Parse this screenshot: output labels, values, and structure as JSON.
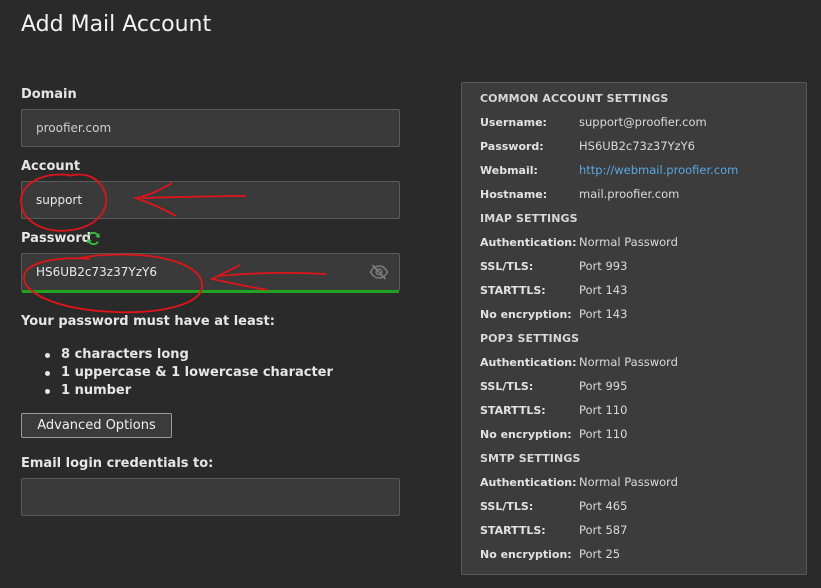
{
  "page": {
    "title": "Add Mail Account"
  },
  "form": {
    "domain_label": "Domain",
    "domain_value": "proofier.com",
    "account_label": "Account",
    "account_value": "support",
    "password_label": "Password",
    "password_value": "HS6UB2c73z37YzY6",
    "requirements_title": "Your password must have at least:",
    "requirements": [
      "8 characters long",
      "1 uppercase & 1 lowercase character",
      "1 number"
    ],
    "advanced_label": "Advanced Options",
    "email_label": "Email login credentials to:",
    "email_value": ""
  },
  "panel": {
    "common": {
      "heading": "COMMON ACCOUNT SETTINGS",
      "username_key": "Username:",
      "username_val": "support@proofier.com",
      "password_key": "Password:",
      "password_val": "HS6UB2c73z37YzY6",
      "webmail_key": "Webmail:",
      "webmail_val": "http://webmail.proofier.com",
      "hostname_key": "Hostname:",
      "hostname_val": "mail.proofier.com"
    },
    "imap": {
      "heading": "IMAP SETTINGS",
      "auth_key": "Authentication:",
      "auth_val": "Normal Password",
      "ssl_key": "SSL/TLS:",
      "ssl_val": "Port 993",
      "starttls_key": "STARTTLS:",
      "starttls_val": "Port 143",
      "noenc_key": "No encryption:",
      "noenc_val": "Port 143"
    },
    "pop3": {
      "heading": "POP3 SETTINGS",
      "auth_key": "Authentication:",
      "auth_val": "Normal Password",
      "ssl_key": "SSL/TLS:",
      "ssl_val": "Port 995",
      "starttls_key": "STARTTLS:",
      "starttls_val": "Port 110",
      "noenc_key": "No encryption:",
      "noenc_val": "Port 110"
    },
    "smtp": {
      "heading": "SMTP SETTINGS",
      "auth_key": "Authentication:",
      "auth_val": "Normal Password",
      "ssl_key": "SSL/TLS:",
      "ssl_val": "Port 465",
      "starttls_key": "STARTTLS:",
      "starttls_val": "Port 587",
      "noenc_key": "No encryption:",
      "noenc_val": "Port 25"
    }
  },
  "icons": {
    "refresh": "refresh-icon",
    "eye": "eye-slash-icon"
  },
  "colors": {
    "strength": "#21a321",
    "link": "#5aa7e0",
    "annotation": "#e0141a",
    "refresh": "#3cbc3c"
  }
}
